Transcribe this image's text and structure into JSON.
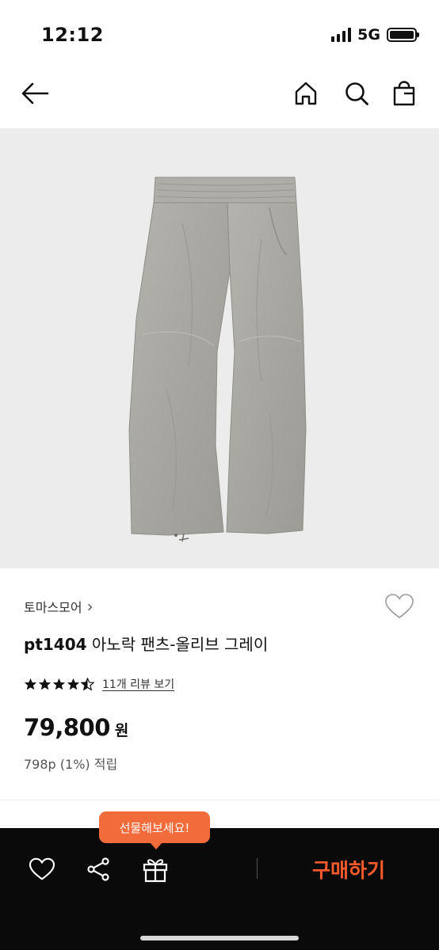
{
  "status_bar": {
    "time": "12:12",
    "network": "5G",
    "icons": [
      "signal-icon",
      "battery-icon"
    ]
  },
  "nav": {
    "icons": [
      "back-arrow-icon",
      "home-icon",
      "search-icon",
      "shopping-bag-icon"
    ]
  },
  "product": {
    "image_alt_icon": "gray-pants-photo",
    "brand": "토마스모어",
    "brand_chevron": "›",
    "title_code": "pt1404",
    "title_rest": " 아노락 팬츠-올리브 그레이",
    "rating": 4.5,
    "rating_max": 5,
    "review_link": "11개 리뷰 보기",
    "price": "79,800",
    "currency": "원",
    "points": "798p (1%) 적립",
    "wish_icon": "heart-outline-icon"
  },
  "bottom_bar": {
    "gift_tooltip": "선물해보세요!",
    "icons": [
      "heart-icon",
      "share-icon",
      "gift-icon"
    ],
    "buy_label": "구매하기"
  },
  "colors": {
    "accent": "#ff5a2c",
    "tooltip_bg": "#f26b3a",
    "bottom_bar_bg": "#0a0a0a",
    "image_bg": "#ececec"
  }
}
